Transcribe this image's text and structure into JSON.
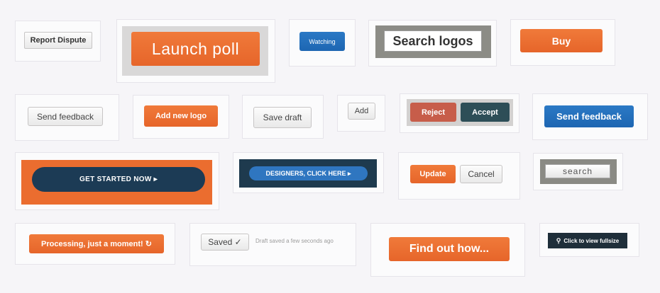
{
  "buttons": {
    "report_dispute": "Report Dispute",
    "launch_poll": "Launch poll",
    "watching": "Watching",
    "search_logos": "Search logos",
    "buy": "Buy",
    "send_feedback_grey": "Send feedback",
    "add_new_logo": "Add new logo",
    "save_draft": "Save draft",
    "add": "Add",
    "reject": "Reject",
    "accept": "Accept",
    "send_feedback_blue": "Send feedback",
    "get_started": "GET STARTED NOW ▸",
    "designers": "DESIGNERS, CLICK HERE ▸",
    "update": "Update",
    "cancel": "Cancel",
    "search": "search",
    "processing": "Processing, just a moment! ↻",
    "saved": "Saved ✓",
    "find_out": "Find out how...",
    "view_fullsize": "Click to view fullsize"
  },
  "draft_status": "Draft saved a few seconds ago",
  "icons": {
    "search": "search-icon",
    "refresh": "refresh-icon",
    "check": "check-icon"
  },
  "colors": {
    "orange": "#e8692c",
    "blue": "#1f6db8",
    "navy": "#1e3a55",
    "background": "#f6f5f8"
  }
}
